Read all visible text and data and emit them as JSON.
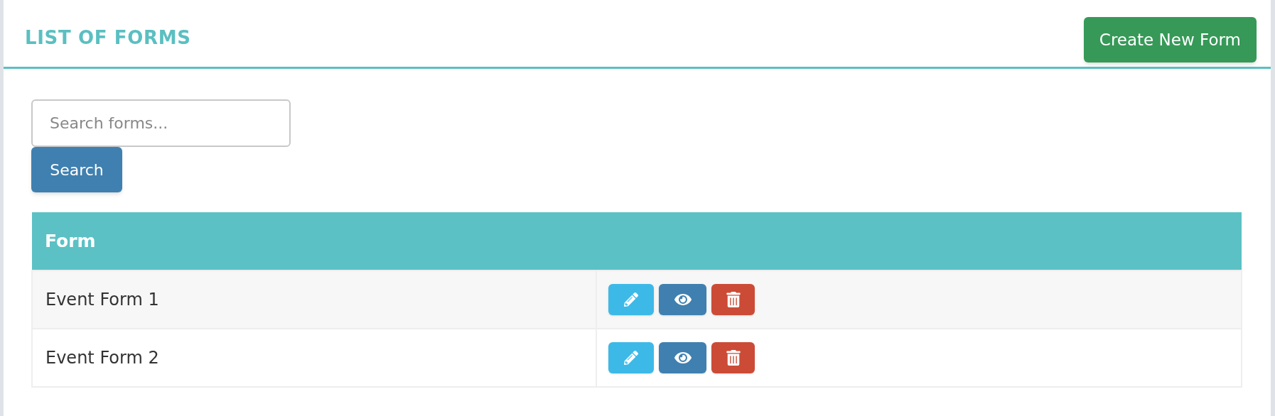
{
  "header": {
    "title": "LIST OF FORMS",
    "create_button": "Create New Form"
  },
  "search": {
    "placeholder": "Search forms...",
    "button": "Search"
  },
  "table": {
    "columns": [
      "Form"
    ],
    "rows": [
      {
        "name": "Event Form 1"
      },
      {
        "name": "Event Form 2"
      }
    ]
  }
}
